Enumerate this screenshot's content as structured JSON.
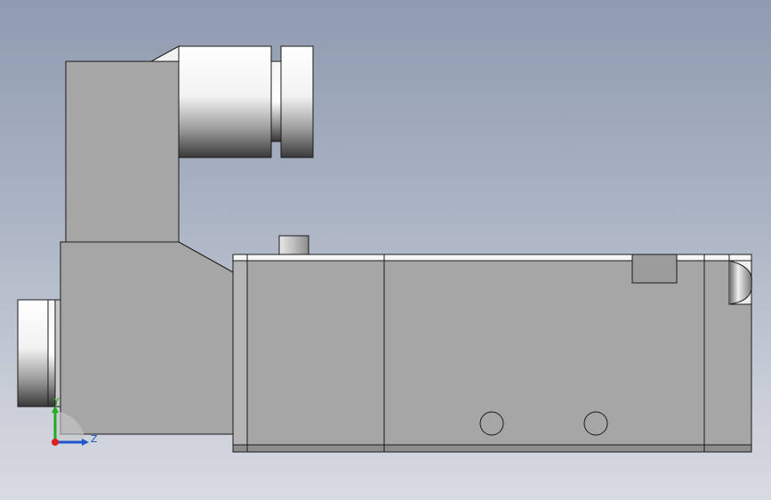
{
  "viewport": {
    "background_top": "#8f9bb0",
    "background_bottom": "#d7dbe2"
  },
  "model": {
    "part_color": "#a6a6a6",
    "edge_color": "#1a1a1a"
  },
  "triad": {
    "y_label": "Y",
    "z_label": "Z",
    "y_color": "#22aa22",
    "z_color": "#2255cc",
    "x_color": "#dd2222"
  }
}
